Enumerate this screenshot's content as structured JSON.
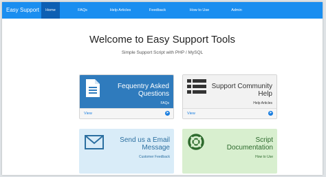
{
  "navbar": {
    "brand": "Easy Support",
    "items": [
      {
        "label": "Home",
        "active": true
      },
      {
        "label": "FAQs",
        "active": false
      },
      {
        "label": "Help Articles",
        "active": false
      },
      {
        "label": "Feedback",
        "active": false
      },
      {
        "label": "How to Use",
        "active": false
      },
      {
        "label": "Admin",
        "active": false
      }
    ]
  },
  "hero": {
    "title": "Welcome to Easy Support Tools",
    "subtitle": "Simple Support Script with PHP / MySQL"
  },
  "cards": [
    {
      "title": "Fequentry Asked Questions",
      "subtitle": "FAQs",
      "footer": "View",
      "icon": "document-icon",
      "color": "#2f7bbd"
    },
    {
      "title": "Support Community Help",
      "subtitle": "Help Articles",
      "footer": "View",
      "icon": "list-icon",
      "color": "#f2f2f2"
    },
    {
      "title": "Send us a Email Message",
      "subtitle": "Customer Feedback",
      "icon": "envelope-icon",
      "color": "#d9ecf8"
    },
    {
      "title": "Script Documentation",
      "subtitle": "How to Use",
      "icon": "lifebuoy-icon",
      "color": "#d8efcf"
    }
  ],
  "colors": {
    "navbar": "#1a8ef0",
    "active_nav": "#0d5fb3",
    "link": "#1a7ee0"
  }
}
